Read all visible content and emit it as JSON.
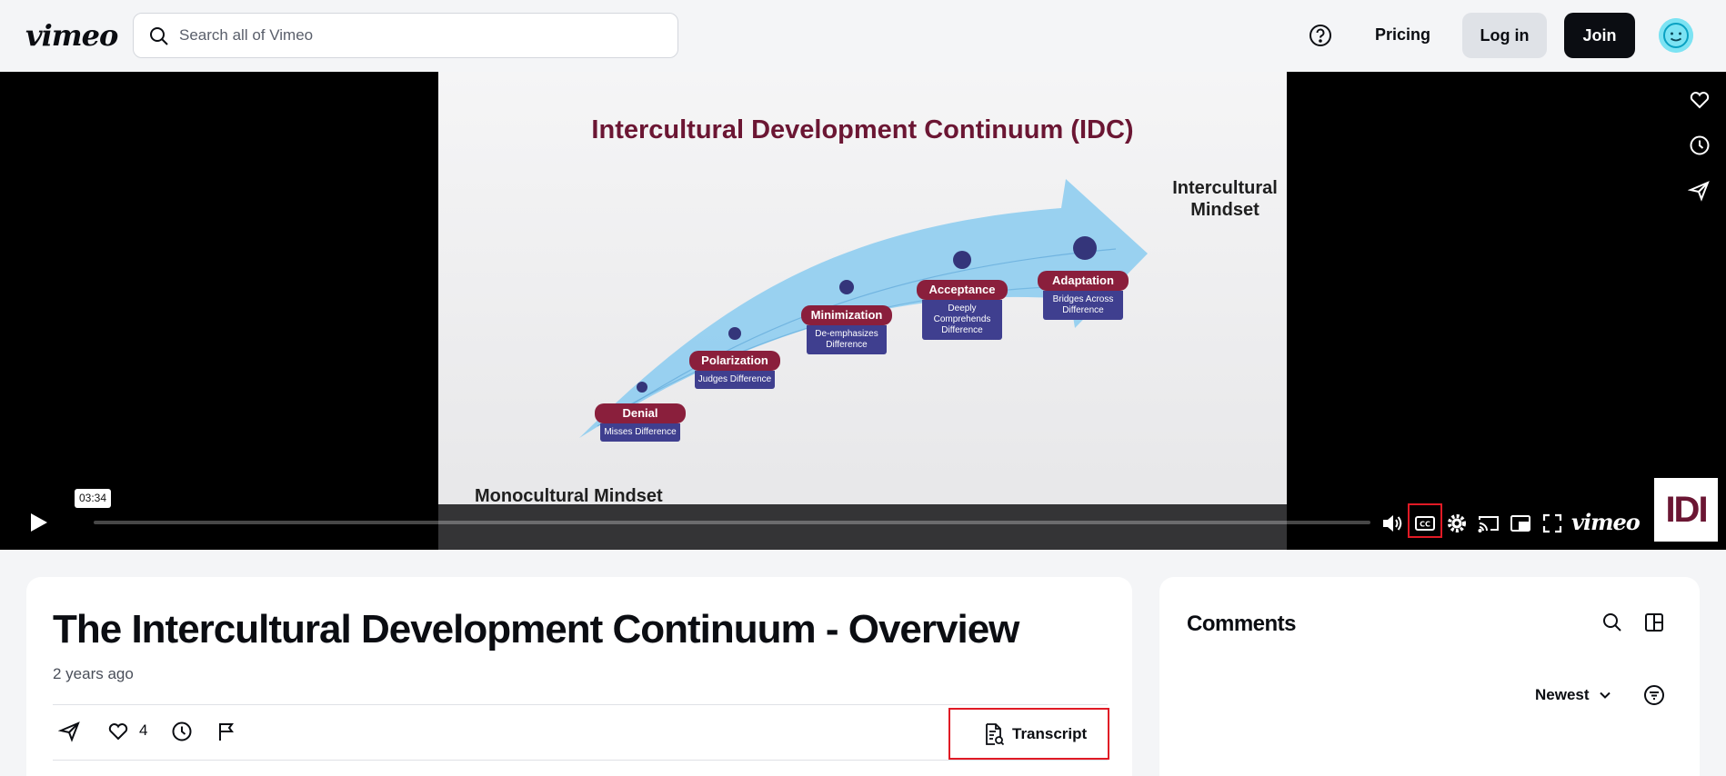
{
  "header": {
    "logo": "vimeo",
    "search_placeholder": "Search all of Vimeo",
    "pricing": "Pricing",
    "login": "Log in",
    "join": "Join"
  },
  "player": {
    "slide": {
      "title": "Intercultural Development Continuum (IDC)",
      "right_label": "Intercultural Mindset",
      "left_label": "Monocultural Mindset",
      "stages": [
        {
          "name": "Denial",
          "desc": "Misses Difference"
        },
        {
          "name": "Polarization",
          "desc": "Judges Difference"
        },
        {
          "name": "Minimization",
          "desc": "De-emphasizes Difference"
        },
        {
          "name": "Acceptance",
          "desc": "Deeply Comprehends Difference"
        },
        {
          "name": "Adaptation",
          "desc": "Bridges Across Difference"
        }
      ]
    },
    "time_tooltip": "03:34",
    "brand": "vimeo",
    "channel_logo": "IDI",
    "colors": {
      "accent_red": "#e01a25",
      "slide_maroon": "#6b1633",
      "stage_blue": "#3f3f8f"
    }
  },
  "video": {
    "title": "The Intercultural Development Continuum - Overview",
    "age": "2 years ago",
    "likes": "4",
    "transcript_label": "Transcript"
  },
  "comments": {
    "title": "Comments",
    "sort": "Newest"
  }
}
